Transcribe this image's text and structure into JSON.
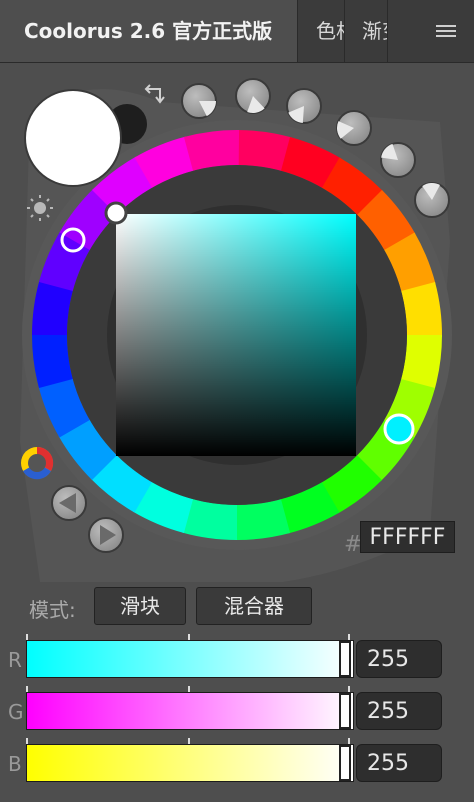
{
  "tabs": {
    "active_label": "Coolorus 2.6 官方正式版",
    "second_label": "色相",
    "third_label": "渐变"
  },
  "colors": {
    "panel_bg": "#4e4e4e",
    "tab_bg": "#3b3b3b",
    "current_color": "#FFFFFF",
    "previous_color": "#1E1E1E",
    "square_hue": "#00FFFF"
  },
  "icons": {
    "swap": "swap-arrows-icon",
    "light": "sun-icon",
    "color_model": "color-triangle-icon",
    "navigate": "triangle-left-icon",
    "play": "play-icon",
    "gamut_count": 7,
    "gamut_masks": [
      "gamut-mask-1-icon",
      "gamut-mask-2-icon",
      "gamut-mask-3-icon",
      "gamut-mask-4-icon",
      "gamut-mask-5-icon",
      "gamut-mask-6-icon",
      "gamut-mask-7-icon"
    ]
  },
  "hex": {
    "hash": "#",
    "value": "FFFFFF"
  },
  "mode": {
    "label": "模式:",
    "slider_label": "滑块",
    "mixer_label": "混合器"
  },
  "channels": [
    {
      "name": "R",
      "value": "255",
      "level": 1.0
    },
    {
      "name": "G",
      "value": "255",
      "level": 1.0
    },
    {
      "name": "B",
      "value": "255",
      "level": 1.0
    }
  ]
}
